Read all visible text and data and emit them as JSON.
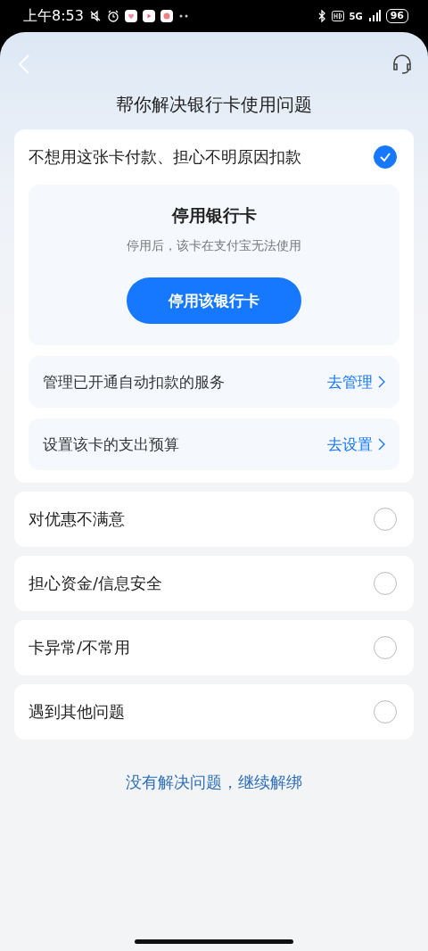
{
  "status_bar": {
    "time": "上午8:53",
    "network": "5G",
    "battery": "96"
  },
  "title": "帮你解决银行卡使用问题",
  "options": [
    {
      "label": "不想用这张卡付款、担心不明原因扣款",
      "selected": true,
      "detail": {
        "heading": "停用银行卡",
        "subtitle": "停用后，该卡在支付宝无法使用",
        "button": "停用该银行卡",
        "actions": [
          {
            "label": "管理已开通自动扣款的服务",
            "link": "去管理"
          },
          {
            "label": "设置该卡的支出预算",
            "link": "去设置"
          }
        ]
      }
    },
    {
      "label": "对优惠不满意",
      "selected": false
    },
    {
      "label": "担心资金/信息安全",
      "selected": false
    },
    {
      "label": "卡异常/不常用",
      "selected": false
    },
    {
      "label": "遇到其他问题",
      "selected": false
    }
  ],
  "footer_link": "没有解决问题，继续解绑"
}
